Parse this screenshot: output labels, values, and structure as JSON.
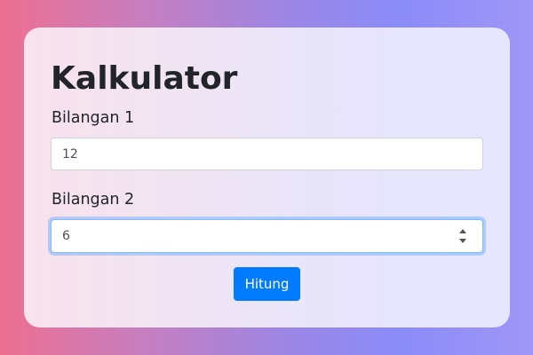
{
  "app": {
    "title": "Kalkulator"
  },
  "form": {
    "field1": {
      "label": "Bilangan 1",
      "value": "12"
    },
    "field2": {
      "label": "Bilangan 2",
      "value": "6"
    },
    "submit_label": "Hitung"
  },
  "colors": {
    "accent": "#007bff",
    "focus_border": "#80bdff"
  },
  "icons": {
    "spinner": "number-spinner-icon"
  }
}
